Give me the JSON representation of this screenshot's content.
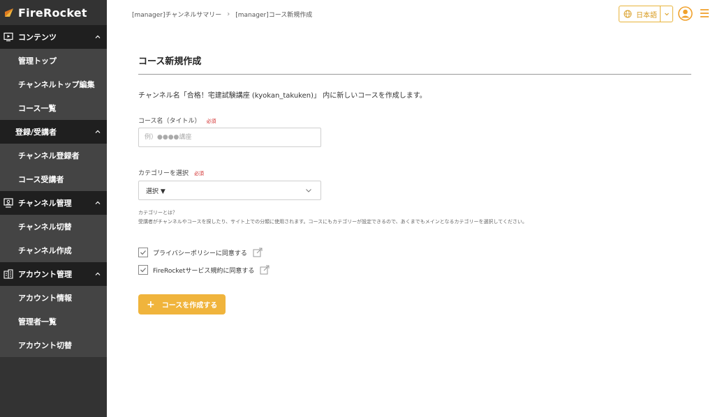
{
  "app": {
    "logo_text": "FireRocket"
  },
  "sidebar": {
    "sections": [
      {
        "label": "コンテンツ",
        "icon": "monitor-play-icon",
        "items": [
          "管理トップ",
          "チャンネルトップ編集",
          "コース一覧"
        ]
      },
      {
        "label": "登録/受講者",
        "icon": "",
        "items": [
          "チャンネル登録者",
          "コース受講者"
        ]
      },
      {
        "label": "チャンネル管理",
        "icon": "presenter-icon",
        "items": [
          "チャンネル切替",
          "チャンネル作成"
        ]
      },
      {
        "label": "アカウント管理",
        "icon": "building-icon",
        "items": [
          "アカウント情報",
          "管理者一覧",
          "アカウント切替"
        ]
      }
    ]
  },
  "header": {
    "breadcrumb": [
      "[manager]チャンネルサマリー",
      "[manager]コース新規作成"
    ],
    "breadcrumb_sep": "›",
    "language": "日本語"
  },
  "main": {
    "title": "コース新規作成",
    "description": "チャンネル名「合格！宅建試験講座 (kyokan_takuken)」 内に新しいコースを作成します。",
    "course_name_label": "コース名（タイトル）",
    "required": "必須",
    "course_name_placeholder": "例）●●●●講座",
    "category_label": "カテゴリーを選択",
    "category_selected": "選択 ▼",
    "help_title": "カテゴリーとは？",
    "help_text": "受講者がチャンネルやコースを探したり、サイト上での分類に使用されます。コースにもカテゴリーが設定できるので、あくまでもメインとなるカテゴリーを選択してください。",
    "privacy_label": "プライバシーポリシーに同意する",
    "terms_label": "FireRocketサービス規約に同意する",
    "create_button": "コースを作成する",
    "create_plus": "+"
  },
  "colors": {
    "accent": "#f0b43c",
    "sidebar_bg": "#333333",
    "sidebar_header_bg": "#1f1f1f",
    "required": "#d12a2a"
  }
}
